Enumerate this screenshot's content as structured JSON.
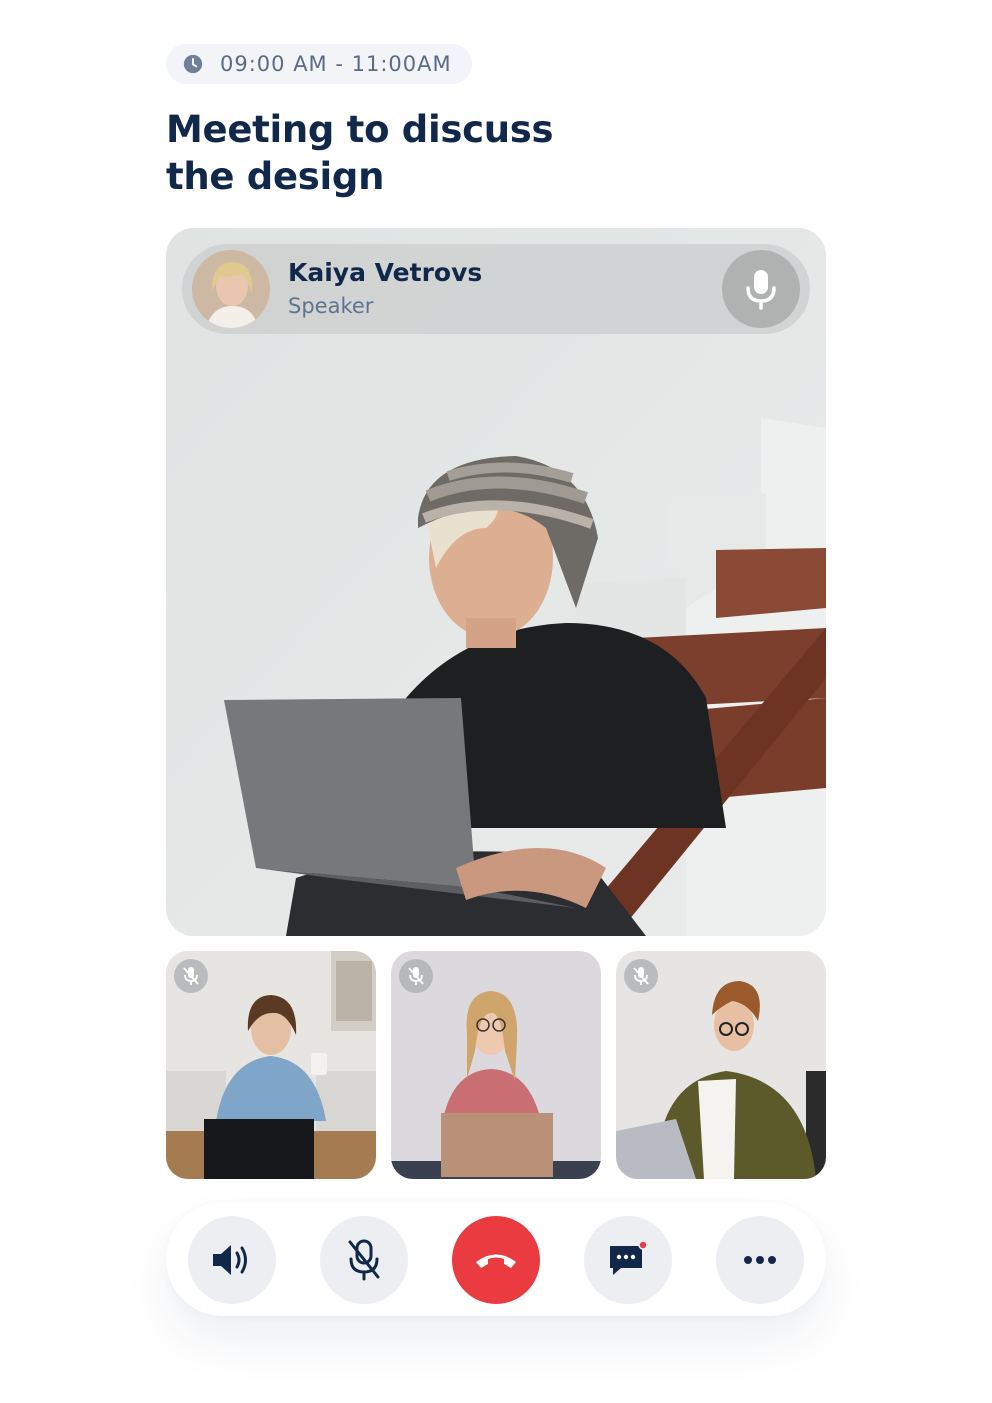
{
  "meeting": {
    "time": "09:00 AM - 11:00AM",
    "title_line1": "Meeting to discuss",
    "title_line2": "the design"
  },
  "speaker": {
    "name": "Kaiya Vetrovs",
    "role": "Speaker"
  },
  "participants": [
    {
      "muted": true
    },
    {
      "muted": true
    },
    {
      "muted": true
    }
  ],
  "controls": {
    "buttons": [
      "speaker-icon",
      "mic-off-icon",
      "end-call-icon",
      "chat-icon",
      "more-icon"
    ],
    "end_color": "#ea3b40",
    "chat_badge_color": "#ea3b40"
  },
  "colors": {
    "title": "#12284a",
    "subtitle": "#5f7391",
    "pill_bg": "#f2f4f7",
    "control_bg": "#eceef1"
  }
}
